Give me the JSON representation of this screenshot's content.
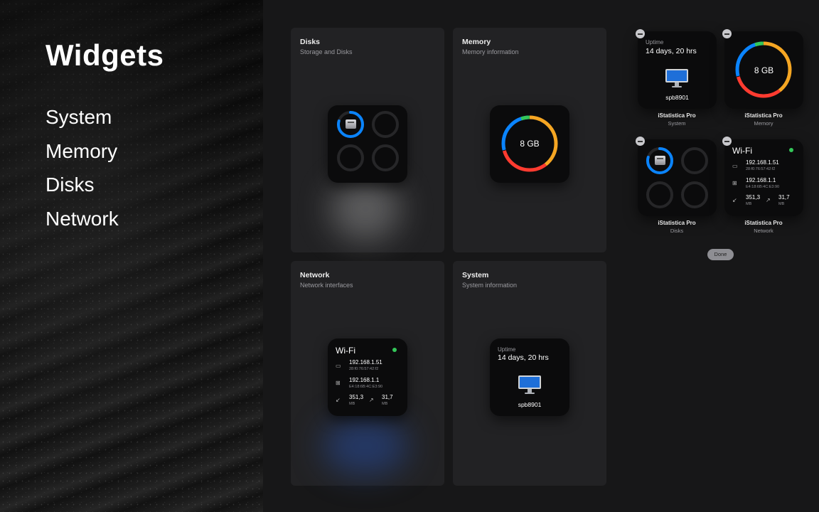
{
  "sidebar": {
    "title": "Widgets",
    "items": [
      {
        "label": "System"
      },
      {
        "label": "Memory"
      },
      {
        "label": "Disks"
      },
      {
        "label": "Network"
      }
    ]
  },
  "cards": {
    "disks": {
      "title": "Disks",
      "subtitle": "Storage and Disks"
    },
    "memory": {
      "title": "Memory",
      "subtitle": "Memory information",
      "value": "8 GB"
    },
    "network": {
      "title": "Network",
      "subtitle": "Network interfaces"
    },
    "system": {
      "title": "System",
      "subtitle": "System information"
    }
  },
  "network": {
    "interface": "Wi-Fi",
    "local_ip": "192.168.1.51",
    "local_mac": "28:f0:76:57:42:f2",
    "router_ip": "192.168.1.1",
    "router_mac": "E4:18:6B:4C:E3:90",
    "download_value": "351,3",
    "download_unit": "MB",
    "upload_value": "31,7",
    "upload_unit": "MB",
    "status_color": "#34c759"
  },
  "system": {
    "uptime_label": "Uptime",
    "uptime_value": "14 days, 20 hrs",
    "hostname": "spb8901"
  },
  "installed": [
    {
      "app": "iStatistica Pro",
      "type": "System"
    },
    {
      "app": "iStatistica Pro",
      "type": "Memory"
    },
    {
      "app": "iStatistica Pro",
      "type": "Disks"
    },
    {
      "app": "iStatistica Pro",
      "type": "Network"
    }
  ],
  "done_label": "Done",
  "memory_ring_colors": [
    "#34c759",
    "#f5a623",
    "#ff3b30",
    "#0a84ff"
  ],
  "disk_usage_fraction": 0.8,
  "icons": [
    "remove-widget-icon",
    "disk-icon",
    "laptop-icon",
    "router-icon",
    "download-icon",
    "upload-icon",
    "imac-icon"
  ]
}
